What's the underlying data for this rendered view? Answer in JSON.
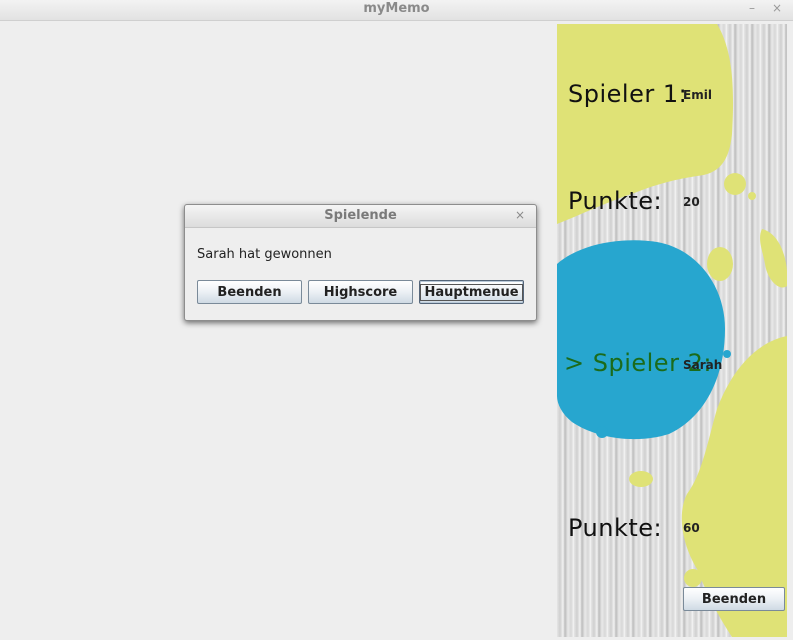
{
  "window": {
    "title": "myMemo",
    "minimize_glyph": "–",
    "close_glyph": "×"
  },
  "side": {
    "player1_label": "Spieler 1:",
    "player1_name": "Emil",
    "points1_label": "Punkte:",
    "points1_value": "20",
    "player2_label": "> Spieler 2:",
    "player2_name": "Sarah",
    "points2_label": "Punkte:",
    "points2_value": "60",
    "quit_button": "Beenden",
    "colors": {
      "yellow": "#dfe276",
      "blue": "#27a6cf",
      "active_player": "#1b6b1b"
    }
  },
  "dialog": {
    "title": "Spielende",
    "close_glyph": "×",
    "message": "Sarah hat gewonnen",
    "buttons": {
      "quit": "Beenden",
      "highscore": "Highscore",
      "main_menu": "Hauptmenue"
    }
  }
}
